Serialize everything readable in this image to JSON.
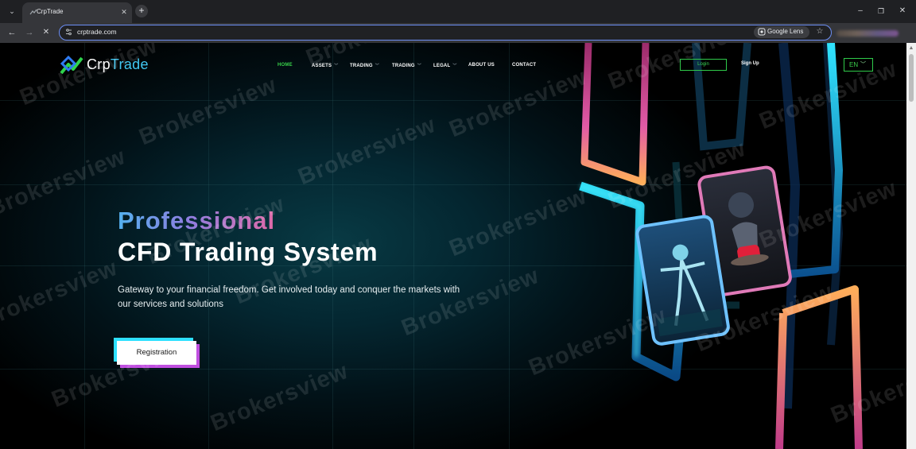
{
  "browser": {
    "tab_menu_glyph": "⌄",
    "tab_title": "CrpTrade",
    "tab_close_glyph": "✕",
    "new_tab_glyph": "+",
    "window_controls": {
      "minimize": "–",
      "restore": "❐",
      "close": "✕"
    },
    "nav": {
      "back": "←",
      "forward": "→",
      "stop": "✕"
    },
    "url": "crptrade.com",
    "lens_label": "Google Lens",
    "icons": [
      "tab-list-icon",
      "favicon-icon",
      "close-icon",
      "plus-icon",
      "back-arrow-icon",
      "forward-arrow-icon",
      "stop-icon",
      "site-info-icon",
      "google-lens-icon",
      "star-icon"
    ]
  },
  "header": {
    "logo": {
      "part1": "Crp",
      "part2": "Trade"
    },
    "nav": [
      {
        "label": "HOME",
        "active": true,
        "caret": false
      },
      {
        "label": "ASSETS",
        "active": false,
        "caret": true
      },
      {
        "label": "TRADING",
        "active": false,
        "caret": true
      },
      {
        "label": "TRADING",
        "active": false,
        "caret": true
      },
      {
        "label": "LEGAL",
        "active": false,
        "caret": true
      },
      {
        "label": "ABOUT US",
        "active": false,
        "caret": false
      },
      {
        "label": "CONTACT",
        "active": false,
        "caret": false
      }
    ],
    "login_label": "Login",
    "signup_label": "Sign Up",
    "language": "EN"
  },
  "hero": {
    "title_line1": "Professional",
    "title_line2": "CFD Trading System",
    "subtitle": "Gateway to your financial freedom. Get involved today and conquer the markets with our services and solutions",
    "cta_label": "Registration"
  },
  "watermark": {
    "text": "Brokersview"
  },
  "colors": {
    "accent_green": "#38d24a",
    "accent_cyan": "#2ee0ff",
    "accent_purple": "#c04fe0",
    "page_bg": "#021218"
  }
}
